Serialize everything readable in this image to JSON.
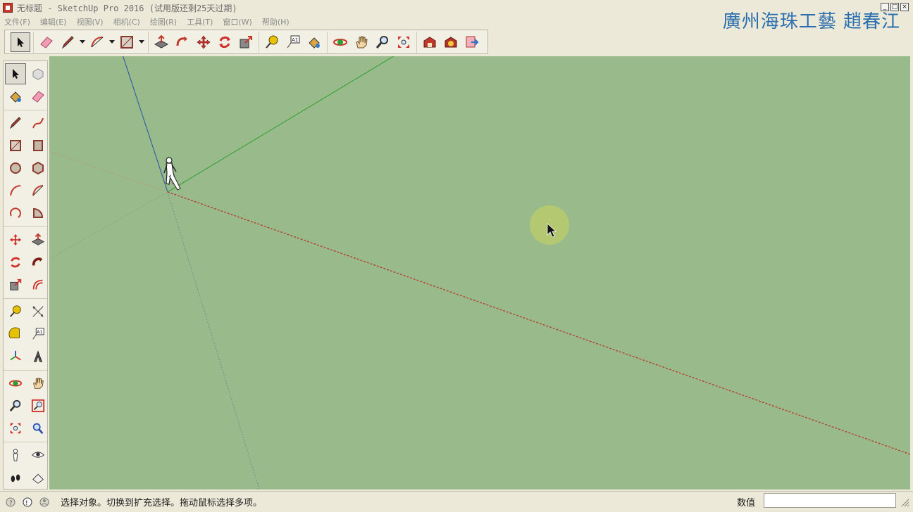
{
  "window": {
    "title": "无标题 - SketchUp Pro 2016 (试用版还剩25天过期)",
    "watermark": "廣州海珠工藝 趙春江",
    "controls": [
      "minimize",
      "restore",
      "close"
    ]
  },
  "menu": [
    {
      "label": "文件(F)"
    },
    {
      "label": "编辑(E)"
    },
    {
      "label": "视图(V)"
    },
    {
      "label": "相机(C)"
    },
    {
      "label": "绘图(R)"
    },
    {
      "label": "工具(T)"
    },
    {
      "label": "窗口(W)"
    },
    {
      "label": "帮助(H)"
    }
  ],
  "toolbar_top": {
    "groups": [
      [
        "select-tool"
      ],
      [
        "eraser-tool",
        "pencil-tool",
        "arc-tool",
        "rectangle-tool"
      ],
      [
        "push-pull-tool",
        "follow-me-tool",
        "move-tool",
        "rotate-tool",
        "scale-tool"
      ],
      [
        "tape-measure-tool",
        "text-tool",
        "paint-bucket-tool"
      ],
      [
        "orbit-tool",
        "pan-tool",
        "zoom-tool",
        "zoom-extents-tool"
      ],
      [
        "3d-warehouse-tool",
        "extension-warehouse-tool",
        "send-to-layout-tool"
      ]
    ],
    "active": "select-tool"
  },
  "toolbar_left": {
    "groups": [
      [
        "select-tool",
        "component-tool",
        "paint-bucket-tool",
        "eraser-tool"
      ],
      [
        "line-tool",
        "freehand-tool",
        "rectangle-tool",
        "rotated-rectangle-tool",
        "circle-tool",
        "polygon-tool",
        "arc-tool",
        "two-point-arc-tool",
        "three-point-arc-tool",
        "pie-tool"
      ],
      [
        "move-tool",
        "push-pull-tool",
        "rotate-tool",
        "follow-me-tool",
        "scale-tool",
        "offset-tool"
      ],
      [
        "tape-measure-tool",
        "dimension-tool",
        "protractor-tool",
        "text-tool",
        "axes-tool",
        "3d-text-tool"
      ],
      [
        "orbit-tool",
        "pan-tool",
        "zoom-tool",
        "zoom-window-tool",
        "zoom-extents-tool",
        "previous-view-tool"
      ],
      [
        "position-camera-tool",
        "look-around-tool",
        "walk-tool",
        "section-plane-tool"
      ]
    ],
    "active": "select-tool"
  },
  "viewport": {
    "background": "#99bb8c",
    "axis_colors": {
      "red": "#b3422f",
      "green": "#2f9e2f",
      "blue": "#2b4fa8"
    }
  },
  "status": {
    "message": "选择对象。切换到扩充选择。拖动鼠标选择多项。",
    "measurements_label": "数值",
    "measurements_value": ""
  }
}
